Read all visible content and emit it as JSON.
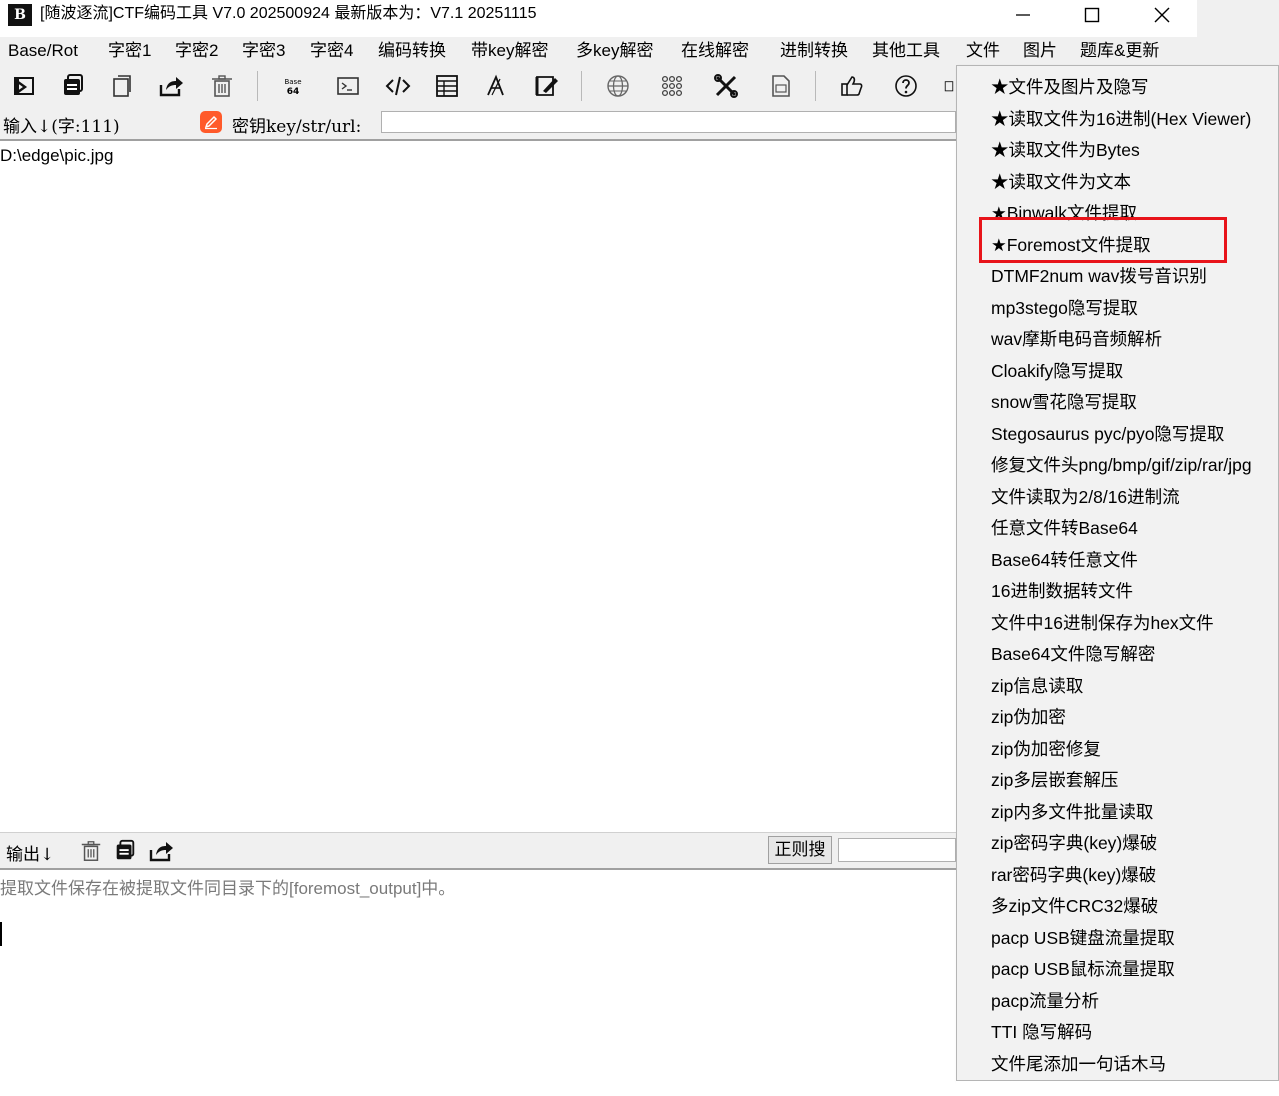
{
  "window": {
    "logo": "B",
    "title": "[随波逐流]CTF编码工具 V7.0 202500924    最新版本为：V7.1  20251115",
    "minimize_glyph": "—",
    "maximize_glyph": "☐",
    "close_glyph": "✕"
  },
  "menubar": {
    "items": [
      "Base/Rot",
      "字密1",
      "字密2",
      "字密3",
      "字密4",
      "编码转换",
      "带key解密",
      "多key解密",
      "在线解密",
      "进制转换",
      "其他工具",
      "文件",
      "图片",
      "题库&更新"
    ]
  },
  "toolbar": {
    "icons": [
      "import-icon",
      "copy-icon",
      "paste-icon",
      "share-icon",
      "delete-icon",
      "base64-icon",
      "terminal-icon",
      "code-icon",
      "table-icon",
      "font-icon",
      "edit-icon",
      "globe-icon",
      "grid-icon",
      "tools-icon",
      "document-icon",
      "thumbs-up-icon",
      "help-icon"
    ]
  },
  "input": {
    "label": "输入↓(字:111)",
    "key_label": "密钥key/str/url:",
    "key_value": "",
    "content": "D:\\edge\\pic.jpg"
  },
  "output": {
    "label": "输出↓",
    "regex_button": "正则搜",
    "regex_value": "",
    "content": "提取文件保存在被提取文件同目录下的[foremost_output]中。"
  },
  "file_menu": {
    "items": [
      "★文件及图片及隐写",
      "★读取文件为16进制(Hex Viewer)",
      "★读取文件为Bytes",
      "★读取文件为文本",
      "★Binwalk文件提取",
      "★Foremost文件提取",
      "DTMF2num  wav拨号音识别",
      "mp3stego隐写提取",
      "wav摩斯电码音频解析",
      "Cloakify隐写提取",
      "snow雪花隐写提取",
      "Stegosaurus pyc/pyo隐写提取",
      "修复文件头png/bmp/gif/zip/rar/jpg",
      "文件读取为2/8/16进制流",
      "任意文件转Base64",
      "Base64转任意文件",
      "16进制数据转文件",
      "文件中16进制保存为hex文件",
      "Base64文件隐写解密",
      "zip信息读取",
      "zip伪加密",
      "zip伪加密修复",
      "zip多层嵌套解压",
      "zip内多文件批量读取",
      "zip密码字典(key)爆破",
      "rar密码字典(key)爆破",
      "多zip文件CRC32爆破",
      "pacp USB键盘流量提取",
      "pacp USB鼠标流量提取",
      "pacp流量分析",
      "TTI 隐写解码",
      "文件尾添加一句话木马"
    ],
    "highlighted_index": 5,
    "highlight_color": "#e8141a"
  }
}
